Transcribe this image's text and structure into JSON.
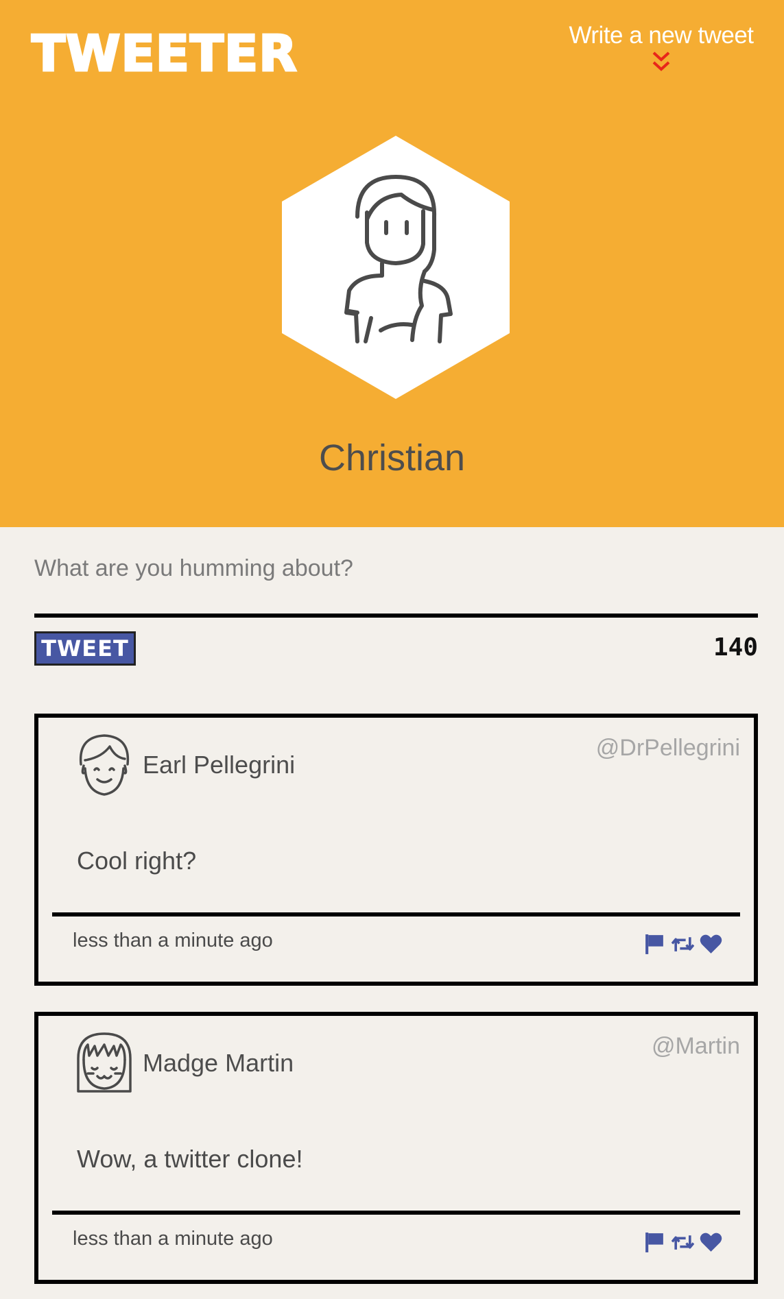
{
  "header": {
    "logo": "TWEETER",
    "compose_link": "Write a new tweet",
    "background_color": "#f5ad33"
  },
  "profile": {
    "name": "Christian",
    "avatar_icon": "woman-avatar-icon"
  },
  "compose": {
    "placeholder": "What are you humming about?",
    "value": "",
    "button_label": "TWEET",
    "char_count": "140"
  },
  "tweets": [
    {
      "name": "Earl Pellegrini",
      "handle": "@DrPellegrini",
      "text": "Cool right?",
      "time": "less than a minute ago",
      "avatar_icon": "man-avatar-icon"
    },
    {
      "name": "Madge Martin",
      "handle": "@Martin",
      "text": "Wow, a twitter clone!",
      "time": "less than a minute ago",
      "avatar_icon": "girl-avatar-icon"
    }
  ],
  "colors": {
    "accent": "#f5ad33",
    "action_blue": "#4757a3",
    "page_bg": "#f3f0eb"
  }
}
